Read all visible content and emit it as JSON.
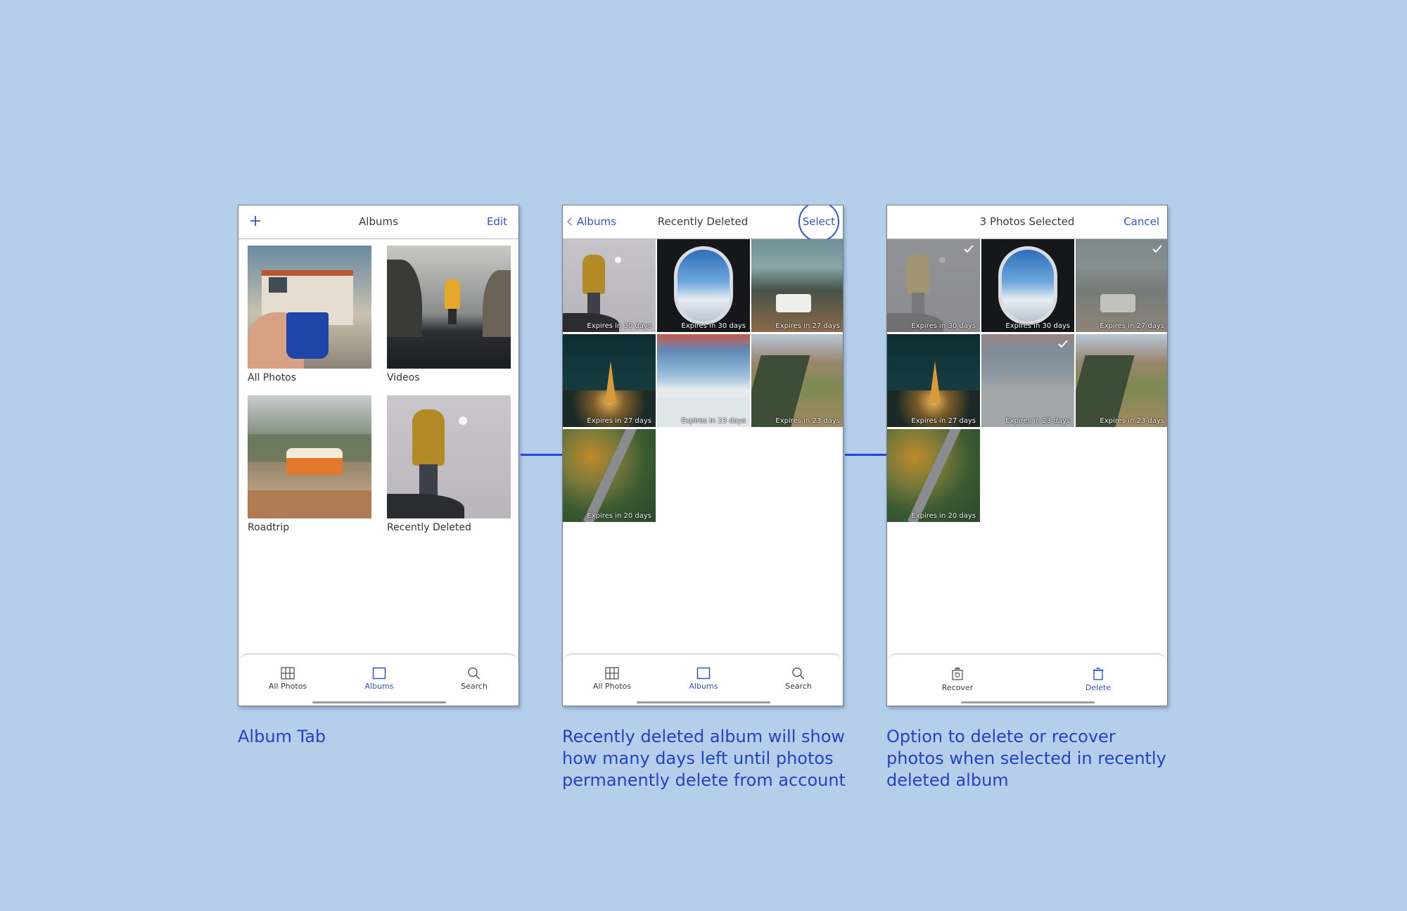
{
  "screen1": {
    "title": "Albums",
    "edit_label": "Edit",
    "albums": [
      {
        "label": "All Photos"
      },
      {
        "label": "Videos"
      },
      {
        "label": "Roadtrip"
      },
      {
        "label": "Recently Deleted"
      }
    ],
    "tabs": [
      {
        "label": "All Photos"
      },
      {
        "label": "Albums"
      },
      {
        "label": "Search"
      }
    ]
  },
  "screen2": {
    "back_label": "Albums",
    "title": "Recently Deleted",
    "select_label": "Select",
    "photos": [
      {
        "expires": "Expires in 30 days"
      },
      {
        "expires": "Expires in 30 days"
      },
      {
        "expires": "Expires in 27 days"
      },
      {
        "expires": "Expires in 27 days"
      },
      {
        "expires": "Expires in 23 days"
      },
      {
        "expires": "Expires in 23 days"
      },
      {
        "expires": "Expires in 20 days"
      }
    ],
    "tabs": [
      {
        "label": "All Photos"
      },
      {
        "label": "Albums"
      },
      {
        "label": "Search"
      }
    ]
  },
  "screen3": {
    "title": "3 Photos Selected",
    "cancel_label": "Cancel",
    "photos": [
      {
        "expires": "Expires in 30 days"
      },
      {
        "expires": "Expires in 30 days"
      },
      {
        "expires": "Expires in 27 days"
      },
      {
        "expires": "Expires in 27 days"
      },
      {
        "expires": "Expires in 23 days"
      },
      {
        "expires": "Expires in 23 days"
      },
      {
        "expires": "Expires in 20 days"
      }
    ],
    "tabs": [
      {
        "label": "Recover"
      },
      {
        "label": "Delete"
      }
    ]
  },
  "captions": {
    "c1": "Album Tab",
    "c2": "Recently deleted album will show how many days left until photos permanently delete from account",
    "c3": "Option to delete or recover photos when selected in recently deleted album"
  },
  "colors": {
    "background": "#b5cfea",
    "accent": "#2f55d4",
    "caption": "#2541c9"
  }
}
